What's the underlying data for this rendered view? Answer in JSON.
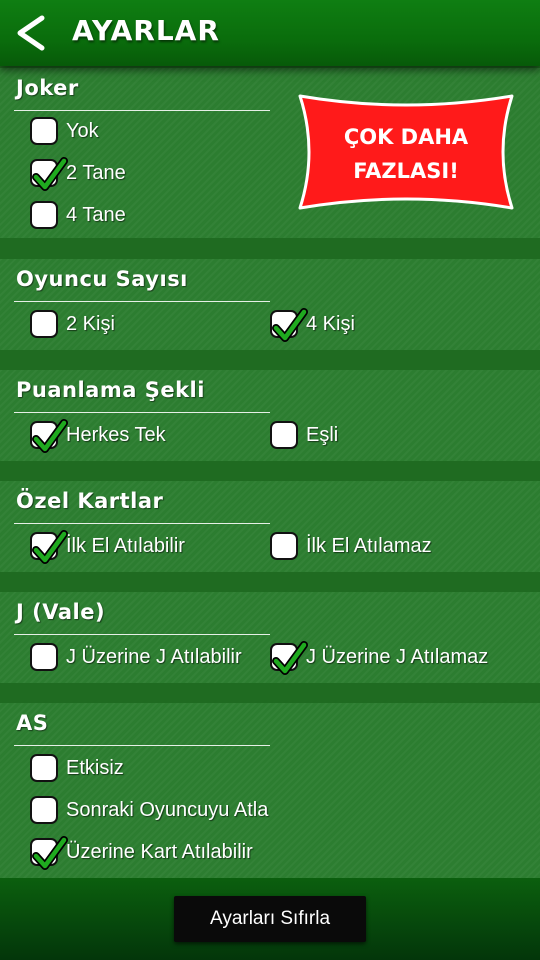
{
  "header": {
    "title": "AYARLAR",
    "back_icon": "back-arrow-icon"
  },
  "promo": {
    "line1": "ÇOK DAHA",
    "line2": "FAZLASI!",
    "color": "#ff1a1a"
  },
  "sections": [
    {
      "title": "Joker",
      "options": [
        {
          "label": "Yok",
          "checked": false
        },
        {
          "label": "2 Tane",
          "checked": true
        },
        {
          "label": "4 Tane",
          "checked": false
        }
      ]
    },
    {
      "title": "Oyuncu Sayısı",
      "options": [
        {
          "label": "2 Kişi",
          "checked": false
        },
        {
          "label": "4 Kişi",
          "checked": true
        }
      ]
    },
    {
      "title": "Puanlama Şekli",
      "options": [
        {
          "label": "Herkes Tek",
          "checked": true
        },
        {
          "label": "Eşli",
          "checked": false
        }
      ]
    },
    {
      "title": "Özel Kartlar",
      "options": [
        {
          "label": "İlk El Atılabilir",
          "checked": true
        },
        {
          "label": "İlk El Atılamaz",
          "checked": false
        }
      ]
    },
    {
      "title": "J (Vale)",
      "options": [
        {
          "label": "J Üzerine J Atılabilir",
          "checked": false
        },
        {
          "label": "J Üzerine J Atılamaz",
          "checked": true
        }
      ]
    },
    {
      "title": "AS",
      "options": [
        {
          "label": "Etkisiz",
          "checked": false
        },
        {
          "label": "Sonraki Oyuncuyu Atla",
          "checked": false
        },
        {
          "label": "Üzerine Kart Atılabilir",
          "checked": true
        }
      ]
    }
  ],
  "footer": {
    "reset_label": "Ayarları Sıfırla"
  },
  "colors": {
    "panel": "#2c7d30",
    "header": "#0a6d0c",
    "check": "#1faa1f"
  }
}
